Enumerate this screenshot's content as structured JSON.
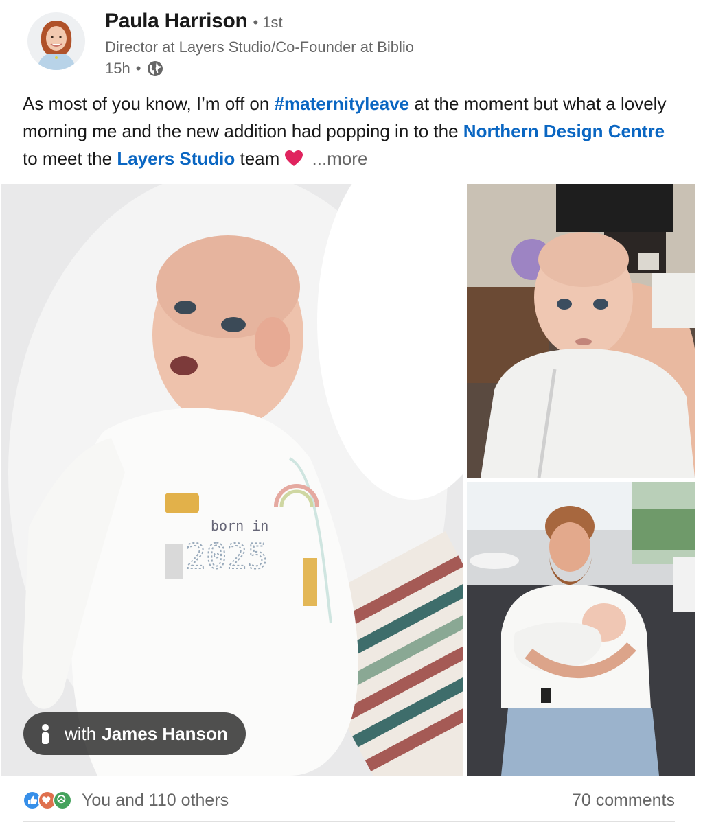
{
  "post": {
    "author": {
      "name": "Paula Harrison",
      "degree": "1st",
      "headline": "Director at Layers Studio/Co-Founder at Biblio",
      "time": "15h",
      "visibility_icon": "globe-icon"
    },
    "text": {
      "part1": "As most of you know, I’m off on ",
      "hashtag": "#maternityleave",
      "part2": " at the moment but what a lovely morning me and the new addition had popping in to the ",
      "mention1": "Northern Design Centre",
      "part3": " to meet the ",
      "mention2": "Layers Studio",
      "part4": " team ",
      "more": "...more"
    },
    "photos": {
      "tag_prefix": "with",
      "tag_name": "James Hanson"
    },
    "social": {
      "reactions_text": "You and 110 others",
      "reaction_icons": [
        "like-icon",
        "love-icon",
        "support-icon"
      ],
      "comments": "70 comments"
    }
  },
  "colors": {
    "link": "#0a66c2",
    "muted": "#666666",
    "text": "#191919"
  }
}
